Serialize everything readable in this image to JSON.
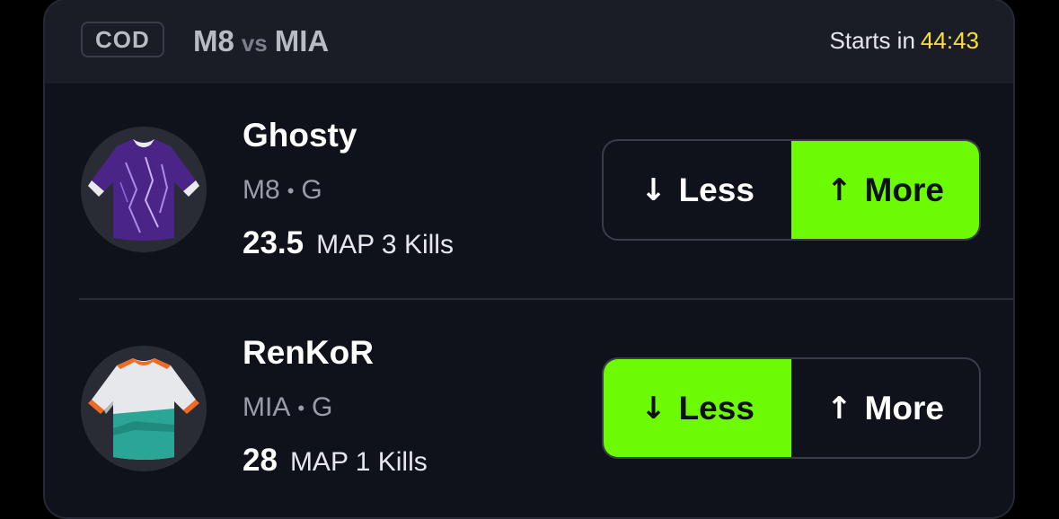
{
  "header": {
    "league": "COD",
    "team_home": "M8",
    "vs": "vs",
    "team_away": "MIA",
    "starts_label": "Starts in",
    "countdown": "44:43"
  },
  "colors": {
    "accent": "#6cfb05",
    "countdown": "#f7de3a",
    "card_bg": "#10121b",
    "header_bg": "#1b1d26"
  },
  "props": [
    {
      "player": "Ghosty",
      "team": "M8",
      "position": "G",
      "line": "23.5",
      "stat": "MAP 3 Kills",
      "jersey_icon": "purple-jersey-icon",
      "less_label": "Less",
      "more_label": "More",
      "selected": "More"
    },
    {
      "player": "RenKoR",
      "team": "MIA",
      "position": "G",
      "line": "28",
      "stat": "MAP 1 Kills",
      "jersey_icon": "teal-white-jersey-icon",
      "less_label": "Less",
      "more_label": "More",
      "selected": "Less"
    }
  ],
  "separator_dot": "•",
  "arrows": {
    "down": "↓",
    "up": "↑"
  }
}
